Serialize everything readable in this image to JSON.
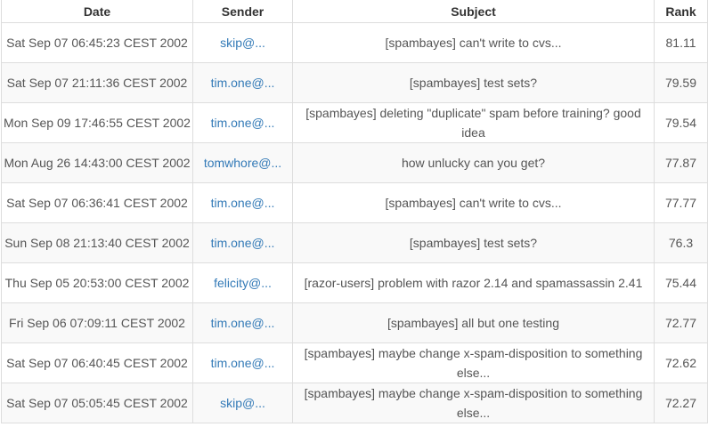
{
  "headers": {
    "date": "Date",
    "sender": "Sender",
    "subject": "Subject",
    "rank": "Rank"
  },
  "rows": [
    {
      "date": "Sat Sep 07 06:45:23 CEST 2002",
      "sender": "skip@...",
      "subject": "[spambayes] can't write to cvs...",
      "rank": "81.11"
    },
    {
      "date": "Sat Sep 07 21:11:36 CEST 2002",
      "sender": "tim.one@...",
      "subject": "[spambayes] test sets?",
      "rank": "79.59"
    },
    {
      "date": "Mon Sep 09 17:46:55 CEST 2002",
      "sender": "tim.one@...",
      "subject": "[spambayes] deleting \"duplicate\" spam before training? good idea",
      "rank": "79.54"
    },
    {
      "date": "Mon Aug 26 14:43:00 CEST 2002",
      "sender": "tomwhore@...",
      "subject": "how unlucky can you get?",
      "rank": "77.87"
    },
    {
      "date": "Sat Sep 07 06:36:41 CEST 2002",
      "sender": "tim.one@...",
      "subject": "[spambayes] can't write to cvs...",
      "rank": "77.77"
    },
    {
      "date": "Sun Sep 08 21:13:40 CEST 2002",
      "sender": "tim.one@...",
      "subject": "[spambayes] test sets?",
      "rank": "76.3"
    },
    {
      "date": "Thu Sep 05 20:53:00 CEST 2002",
      "sender": "felicity@...",
      "subject": "[razor-users] problem with razor 2.14 and spamassassin 2.41",
      "rank": "75.44"
    },
    {
      "date": "Fri Sep 06 07:09:11 CEST 2002",
      "sender": "tim.one@...",
      "subject": "[spambayes] all but one testing",
      "rank": "72.77"
    },
    {
      "date": "Sat Sep 07 06:40:45 CEST 2002",
      "sender": "tim.one@...",
      "subject": "[spambayes] maybe change x-spam-disposition to something else...",
      "rank": "72.62"
    },
    {
      "date": "Sat Sep 07 05:05:45 CEST 2002",
      "sender": "skip@...",
      "subject": "[spambayes] maybe change x-spam-disposition to something else...",
      "rank": "72.27"
    }
  ],
  "colors": {
    "link": "#337ab7",
    "text": "#555555",
    "header_text": "#333333",
    "border": "#dddddd",
    "row_alt": "#f9f9f9"
  }
}
